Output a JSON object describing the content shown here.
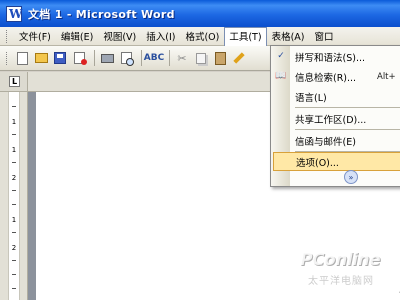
{
  "window": {
    "title": "文档 1 - Microsoft Word"
  },
  "menubar": {
    "items": [
      {
        "label": "文件(F)"
      },
      {
        "label": "编辑(E)"
      },
      {
        "label": "视图(V)"
      },
      {
        "label": "插入(I)"
      },
      {
        "label": "格式(O)"
      },
      {
        "label": "工具(T)"
      },
      {
        "label": "表格(A)"
      },
      {
        "label": "窗口"
      }
    ],
    "active_index": 5
  },
  "toolbar": {
    "icons": [
      "new-document-icon",
      "open-icon",
      "save-icon",
      "permission-icon",
      "print-icon",
      "print-preview-icon",
      "spelling-icon",
      "cut-icon",
      "copy-icon",
      "paste-icon",
      "format-painter-icon"
    ]
  },
  "ruler": {
    "tab_marker": "L",
    "vertical_numbers": [
      "1",
      "1",
      "2",
      "1",
      "2"
    ]
  },
  "tools_menu": {
    "items": [
      {
        "label": "拼写和语法(S)...",
        "shortcut": "",
        "icon": "spelling-grammar-icon"
      },
      {
        "label": "信息检索(R)...",
        "shortcut": "Alt+",
        "icon": "research-icon"
      },
      {
        "label": "语言(L)",
        "shortcut": "",
        "icon": ""
      },
      {
        "label": "共享工作区(D)...",
        "shortcut": "",
        "icon": ""
      },
      {
        "label": "信函与邮件(E)",
        "shortcut": "",
        "icon": ""
      },
      {
        "label": "选项(O)...",
        "shortcut": "",
        "icon": "",
        "highlighted": true
      }
    ],
    "more_icon": "chevron-double-down-icon"
  },
  "document": {
    "paragraph_mark": "↵"
  },
  "watermark": {
    "brand": "PConline",
    "sub": "太平洋电脑网"
  },
  "colors": {
    "titlebar": "#0b4fcd",
    "highlight": "#ffe8a6",
    "canvas": "#8c929c"
  }
}
